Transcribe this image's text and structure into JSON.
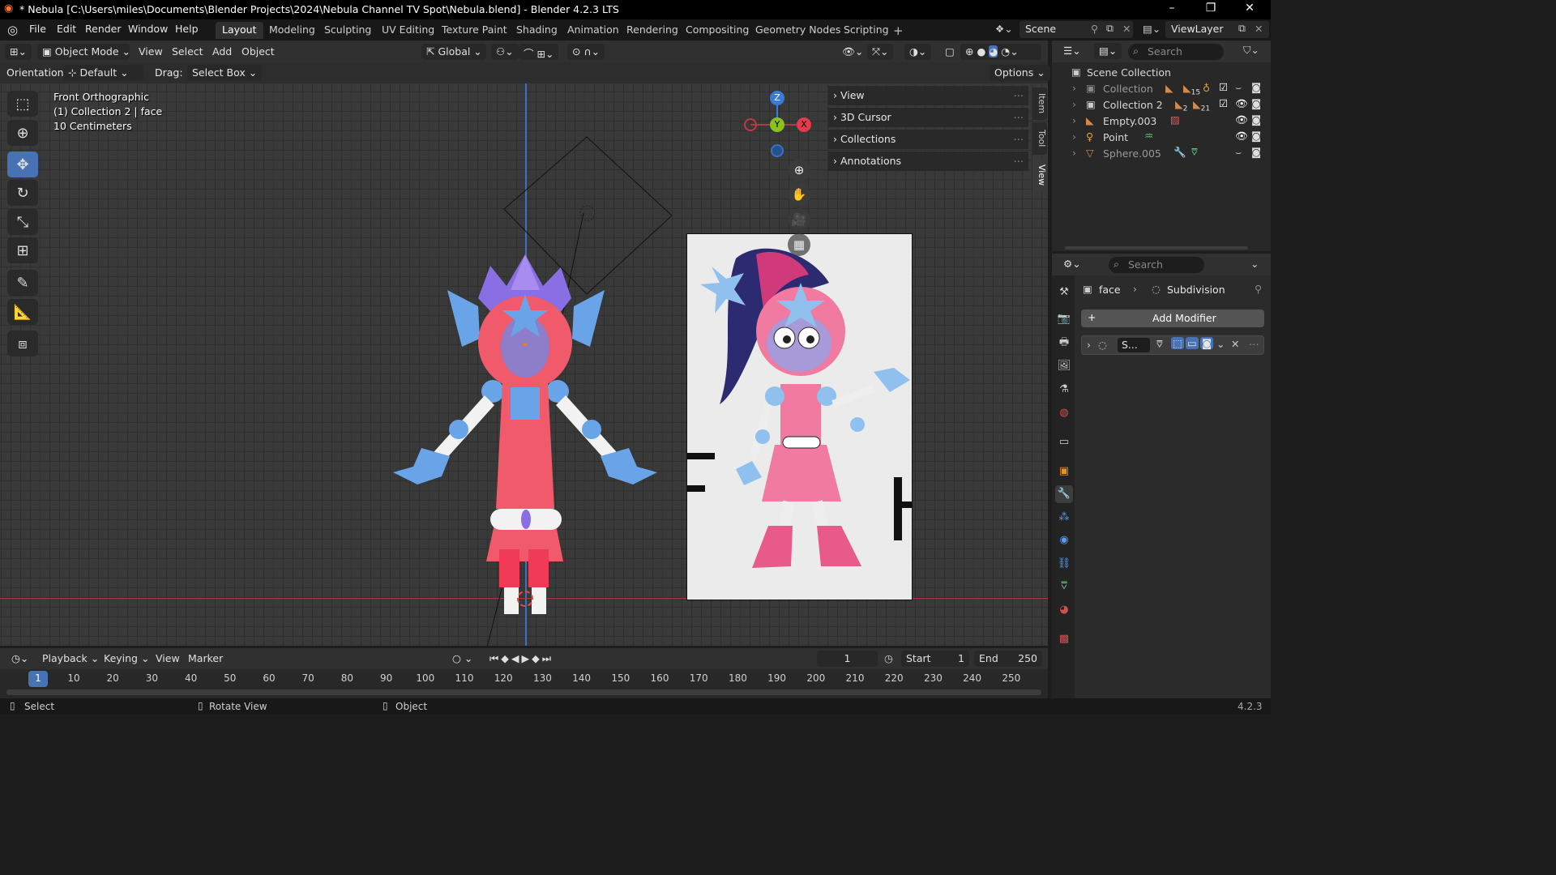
{
  "window": {
    "title": "* Nebula [C:\\Users\\miles\\Documents\\Blender Projects\\2024\\Nebula Channel TV Spot\\Nebula.blend] - Blender 4.2.3 LTS"
  },
  "menus": [
    "File",
    "Edit",
    "Render",
    "Window",
    "Help"
  ],
  "workspaces": [
    "Layout",
    "Modeling",
    "Sculpting",
    "UV Editing",
    "Texture Paint",
    "Shading",
    "Animation",
    "Rendering",
    "Compositing",
    "Geometry Nodes",
    "Scripting"
  ],
  "active_workspace": "Layout",
  "scene": {
    "name": "Scene",
    "viewlayer": "ViewLayer"
  },
  "viewport_header": {
    "mode": "Object Mode",
    "menus": [
      "View",
      "Select",
      "Add",
      "Object"
    ],
    "transform": "Global"
  },
  "tool_header": {
    "orientation_label": "Orientation:",
    "orientation": "Default",
    "drag_label": "Drag:",
    "drag": "Select Box",
    "options": "Options"
  },
  "viewport_overlay": {
    "view_name": "Front Orthographic",
    "collection": "(1) Collection 2 | face",
    "scale": "10 Centimeters"
  },
  "gizmo": {
    "z": "Z",
    "y": "Y",
    "x": "X"
  },
  "npanel": {
    "rows": [
      "View",
      "3D Cursor",
      "Collections",
      "Annotations"
    ],
    "tabs": [
      "Item",
      "Tool",
      "View"
    ]
  },
  "outliner": {
    "search_placeholder": "Search",
    "root": "Scene Collection",
    "items": [
      {
        "name": "Collection",
        "badge1": "15",
        "dim": true
      },
      {
        "name": "Collection 2",
        "badge1": "2",
        "badge2": "21",
        "dim": false
      },
      {
        "name": "Empty.003",
        "dim": false
      },
      {
        "name": "Point",
        "dim": false
      },
      {
        "name": "Sphere.005",
        "dim": true
      }
    ]
  },
  "properties": {
    "search_placeholder": "Search",
    "object": "face",
    "modifier_type": "Subdivision",
    "add_modifier": "Add Modifier",
    "modifier_short_name": "S..."
  },
  "timeline": {
    "menus": [
      "Playback",
      "Keying",
      "View",
      "Marker"
    ],
    "current_frame": "1",
    "start_label": "Start",
    "start": "1",
    "end_label": "End",
    "end": "250",
    "ticks": [
      "1",
      "10",
      "20",
      "30",
      "40",
      "50",
      "60",
      "70",
      "80",
      "90",
      "100",
      "110",
      "120",
      "130",
      "140",
      "150",
      "160",
      "170",
      "180",
      "190",
      "200",
      "210",
      "220",
      "230",
      "240",
      "250"
    ]
  },
  "status": {
    "select": "Select",
    "rotate": "Rotate View",
    "object": "Object",
    "version": "4.2.3"
  },
  "colors": {
    "accent": "#4772b3",
    "x_axis": "#e23b4b",
    "y_axis": "#8bc21c",
    "z_axis": "#3b7bd8"
  }
}
